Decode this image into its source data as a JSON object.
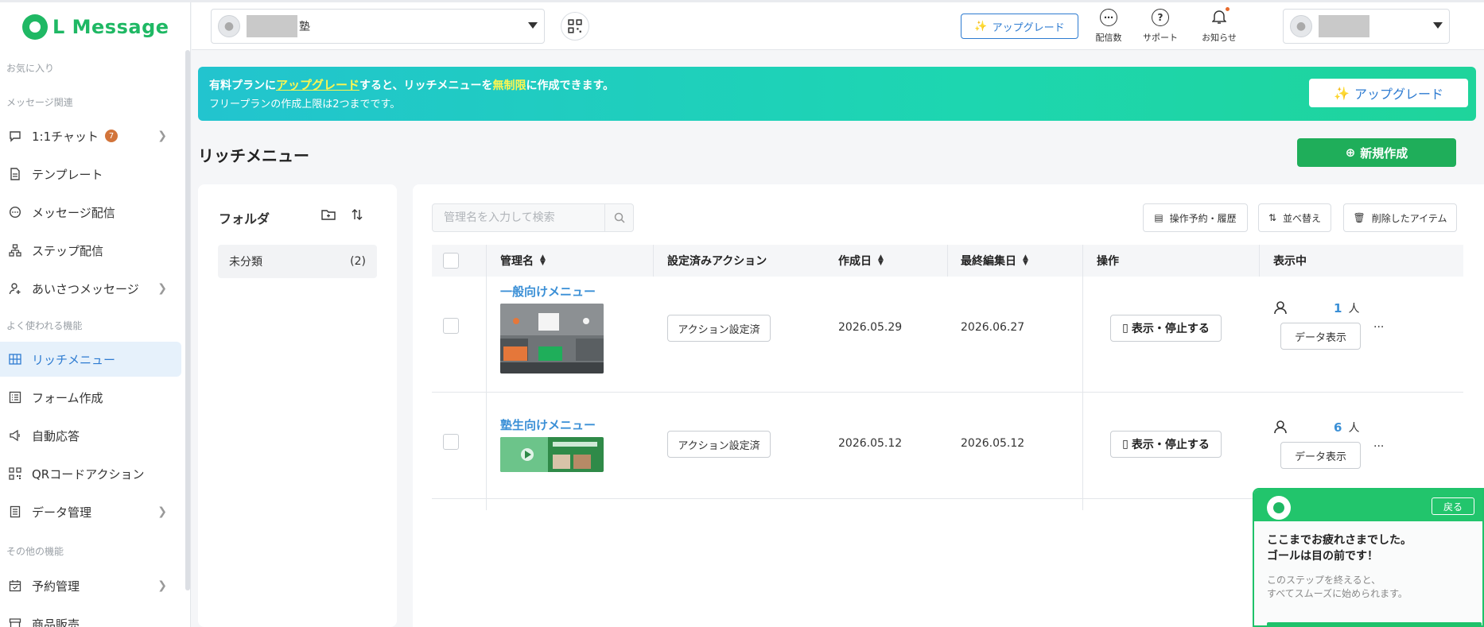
{
  "sidebar": {
    "logo": "L Message",
    "sections": {
      "favorites": "お気に入り",
      "message": "メッセージ関連",
      "frequent": "よく使われる機能",
      "other": "その他の機能"
    },
    "items": [
      {
        "label": "1:1チャット",
        "badge": "7"
      },
      {
        "label": "テンプレート"
      },
      {
        "label": "メッセージ配信"
      },
      {
        "label": "ステップ配信"
      },
      {
        "label": "あいさつメッセージ"
      },
      {
        "label": "リッチメニュー"
      },
      {
        "label": "フォーム作成"
      },
      {
        "label": "自動応答"
      },
      {
        "label": "QRコードアクション"
      },
      {
        "label": "データ管理"
      },
      {
        "label": "予約管理"
      },
      {
        "label": "商品販売"
      }
    ]
  },
  "header": {
    "account_suffix": "塾",
    "upgrade": "アップグレード",
    "tools": [
      {
        "label": "配信数",
        "icon": "chat-bubble-icon"
      },
      {
        "label": "サポート",
        "icon": "question-icon"
      },
      {
        "label": "お知らせ",
        "icon": "bell-icon"
      }
    ]
  },
  "banner": {
    "line1_pre": "有料プランに",
    "line1_link": "アップグレード",
    "line1_mid": "すると、リッチメニューを",
    "line1_hl": "無制限",
    "line1_post": "に作成できます。",
    "line2": "フリープランの作成上限は2つまでです。",
    "button": "アップグレード"
  },
  "page": {
    "title": "リッチメニュー",
    "new_button": "新規作成"
  },
  "folders": {
    "title": "フォルダ",
    "items": [
      {
        "name": "未分類",
        "count": "(2)"
      }
    ]
  },
  "toolbar": {
    "search_placeholder": "管理名を入力して検索",
    "schedule": "操作予約・履歴",
    "sort": "並べ替え",
    "deleted": "削除したアイテム"
  },
  "table": {
    "headers": {
      "name": "管理名",
      "actions": "設定済みアクション",
      "created": "作成日",
      "edited": "最終編集日",
      "ops": "操作",
      "displaying": "表示中"
    },
    "rows": [
      {
        "name": "一般向けメニュー",
        "action": "アクション設定済",
        "created": "2026.05.29",
        "edited": "2026.06.27",
        "op": "表示・停止する",
        "count": "1",
        "unit": "人",
        "data_btn": "データ表示",
        "more": "..."
      },
      {
        "name": "塾生向けメニュー",
        "action": "アクション設定済",
        "created": "2026.05.12",
        "edited": "2026.05.12",
        "op": "表示・停止する",
        "count": "6",
        "unit": "人",
        "data_btn": "データ表示",
        "more": "..."
      }
    ]
  },
  "guide": {
    "back": "戻る",
    "title_l1": "ここまでお疲れさまでした。",
    "title_l2": "ゴールは目の前です！",
    "body_l1": "このステップを終えると、",
    "body_l2": "すべてスムーズに始められます。"
  }
}
